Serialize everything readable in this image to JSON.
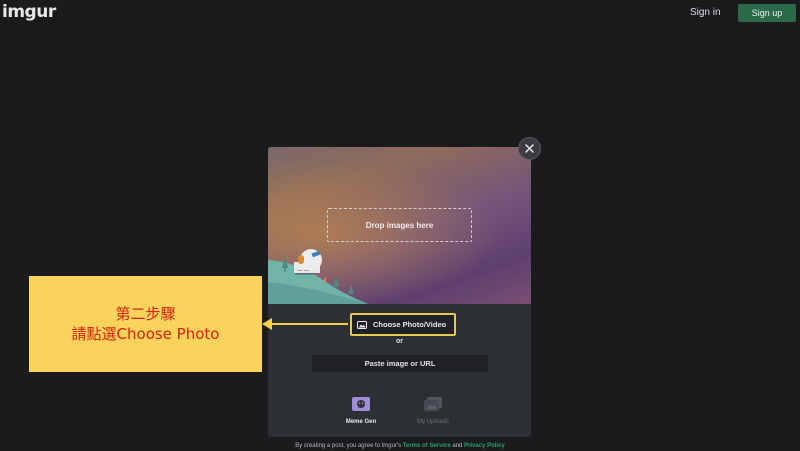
{
  "header": {
    "logo": "imgur",
    "signin_label": "Sign in",
    "signup_label": "Sign up"
  },
  "upload_modal": {
    "dropzone_label": "Drop images here",
    "choose_label": "Choose Photo/Video",
    "or_label": "or",
    "paste_label": "Paste image or URL",
    "tools": [
      {
        "label": "Meme Gen",
        "icon": "meme-gen-icon"
      },
      {
        "label": "My Uploads",
        "icon": "my-uploads-icon"
      }
    ]
  },
  "footer": {
    "prefix": "By creating a post, you agree to Imgur's",
    "terms_label": "Terms of Service",
    "and": "and",
    "privacy_label": "Privacy Policy"
  },
  "annotation": {
    "line1": "第二步驟",
    "line2": "請點選Choose Photo",
    "color": "#d2230e",
    "background": "#f9d35c"
  },
  "colors": {
    "accent_green": "#2b6a47",
    "link_green": "#27a16a",
    "highlight_yellow": "#e9c84a"
  }
}
